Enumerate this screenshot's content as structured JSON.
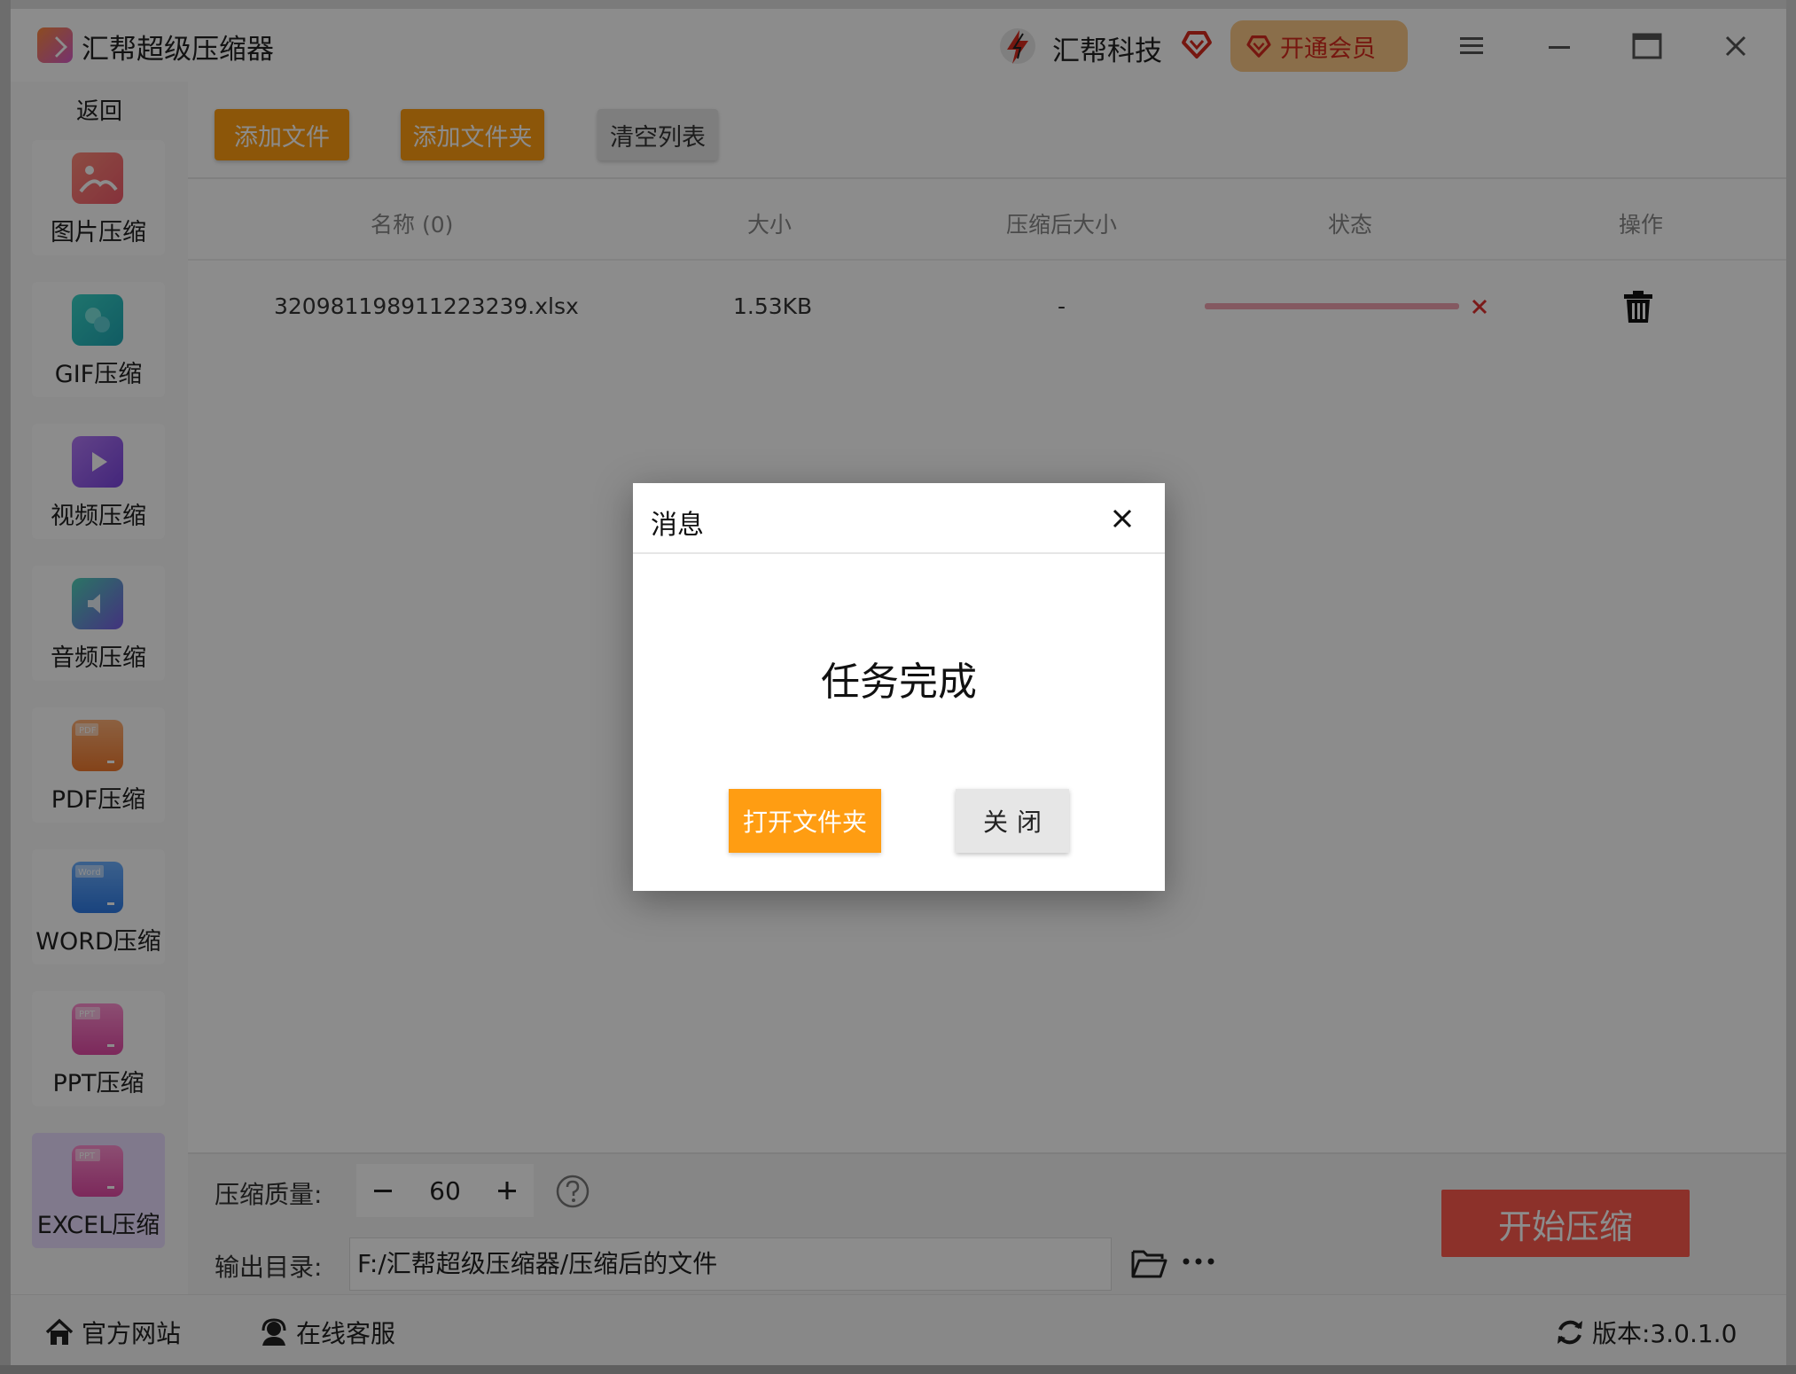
{
  "app": {
    "title": "汇帮超级压缩器",
    "brand_name": "汇帮科技",
    "vip_label": "开通会员"
  },
  "sidebar": {
    "back_label": "返回",
    "items": [
      {
        "label": "图片压缩",
        "icon": "image-icon",
        "color": "#f06a6a"
      },
      {
        "label": "GIF压缩",
        "icon": "gif-icon",
        "color": "#2ec2c0"
      },
      {
        "label": "视频压缩",
        "icon": "video-icon",
        "color": "#9b5cf0"
      },
      {
        "label": "音频压缩",
        "icon": "audio-icon",
        "color": "#4aa6d8"
      },
      {
        "label": "PDF压缩",
        "icon": "pdf-icon",
        "color": "#f08a3c",
        "badge": "PDF"
      },
      {
        "label": "WORD压缩",
        "icon": "word-icon",
        "color": "#3c8bf0",
        "badge": "Word"
      },
      {
        "label": "PPT压缩",
        "icon": "ppt-icon",
        "color": "#e85cb2",
        "badge": "PPT"
      },
      {
        "label": "EXCEL压缩",
        "icon": "excel-icon",
        "color": "#e85cb2",
        "badge": "PPT"
      }
    ]
  },
  "toolbar": {
    "add_file": "添加文件",
    "add_folder": "添加文件夹",
    "clear_list": "清空列表"
  },
  "table": {
    "headers": [
      "名称 (0)",
      "大小",
      "压缩后大小",
      "状态",
      "操作"
    ],
    "rows": [
      {
        "name": "320981198911223239.xlsx",
        "size": "1.53KB",
        "compressed_size": "-",
        "progress": 1.0
      }
    ]
  },
  "settings": {
    "quality_label": "压缩质量:",
    "quality_value": "60",
    "output_label": "输出目录:",
    "output_path": "F:/汇帮超级压缩器/压缩后的文件",
    "start_label": "开始压缩"
  },
  "footer": {
    "website": "官方网站",
    "support": "在线客服",
    "version": "版本:3.0.1.0"
  },
  "dialog": {
    "title": "消息",
    "message": "任务完成",
    "open_folder": "打开文件夹",
    "close": "关闭"
  },
  "colors": {
    "accent_orange": "#ff9d12",
    "start_red": "#ff5a4e",
    "vip_bg": "#fbc987",
    "vip_text": "#d72b1e"
  }
}
